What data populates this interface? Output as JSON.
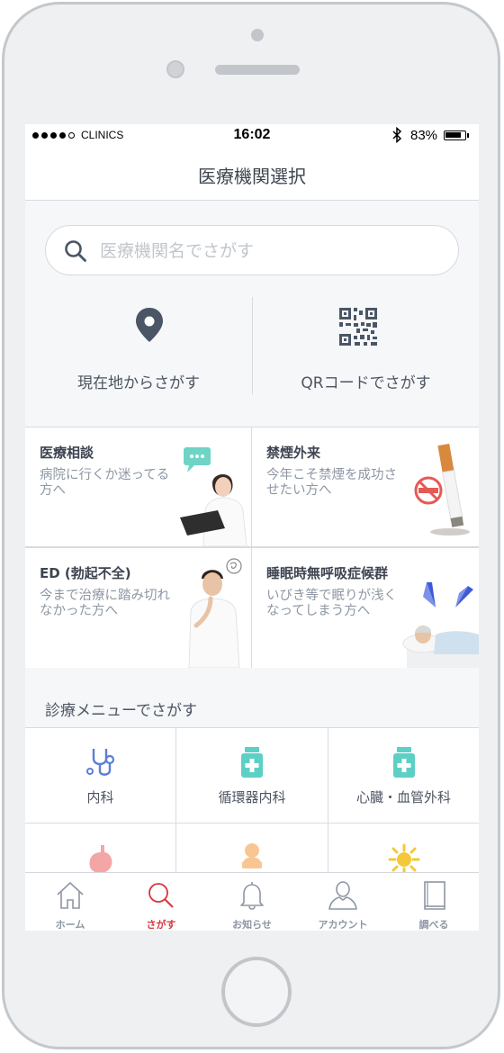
{
  "status": {
    "carrier": "CLINICS",
    "time": "16:02",
    "bluetooth_icon": "bluetooth-icon",
    "battery": "83%",
    "battery_level": 0.83
  },
  "nav": {
    "title": "医療機関選択"
  },
  "search": {
    "placeholder": "医療機関名でさがす",
    "icon": "search-icon"
  },
  "quick": {
    "location_label": "現在地からさがす",
    "location_icon": "map-pin-icon",
    "qr_label": "QRコードでさがす",
    "qr_icon": "qr-code-icon"
  },
  "cards": [
    {
      "title": "医療相談",
      "desc": "病院に行くか迷ってる方へ"
    },
    {
      "title": "禁煙外来",
      "desc": "今年こそ禁煙を成功させたい方へ"
    },
    {
      "title": "ED (勃起不全)",
      "desc": "今まで治療に踏み切れなかった方へ"
    },
    {
      "title": "睡眠時無呼吸症候群",
      "desc": "いびき等で眠りが浅くなってしまう方へ"
    }
  ],
  "menu_section": {
    "title": "診療メニューでさがす"
  },
  "menu": [
    {
      "label": "内科",
      "icon": "stethoscope-icon"
    },
    {
      "label": "循環器内科",
      "icon": "medicine-bottle-icon"
    },
    {
      "label": "心臓・血管外科",
      "icon": "medicine-bottle-icon"
    },
    {
      "label": "",
      "icon": "stomach-icon"
    },
    {
      "label": "",
      "icon": "baby-icon"
    },
    {
      "label": "",
      "icon": "sun-icon"
    }
  ],
  "tabs": [
    {
      "label": "ホーム",
      "icon": "home-icon",
      "active": false
    },
    {
      "label": "さがす",
      "icon": "search-icon",
      "active": true
    },
    {
      "label": "お知らせ",
      "icon": "bell-icon",
      "active": false
    },
    {
      "label": "アカウント",
      "icon": "user-icon",
      "active": false
    },
    {
      "label": "調べる",
      "icon": "book-icon",
      "active": false
    }
  ],
  "colors": {
    "accent_active": "#d9363e",
    "teal": "#5ecfc4",
    "text_primary": "#3d4450",
    "text_secondary": "#8d96a3",
    "icon_dark": "#4a5666"
  }
}
